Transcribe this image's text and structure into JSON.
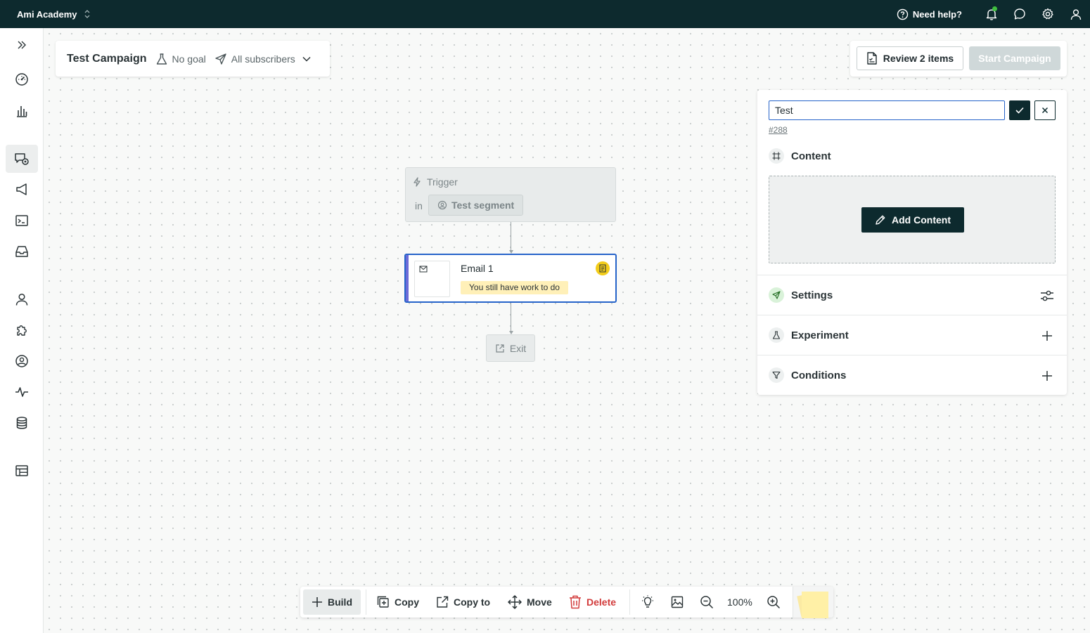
{
  "topbar": {
    "workspace": "Ami Academy",
    "help_label": "Need help?"
  },
  "campaign": {
    "title": "Test Campaign",
    "goal": "No goal",
    "audience": "All subscribers"
  },
  "actions": {
    "review_label": "Review 2 items",
    "start_label": "Start Campaign"
  },
  "flow": {
    "trigger_label": "Trigger",
    "trigger_in": "in",
    "segment": "Test segment",
    "email_title": "Email 1",
    "email_status": "You still have work to do",
    "exit_label": "Exit"
  },
  "panel": {
    "name_value": "Test",
    "message_id": "#288",
    "content_label": "Content",
    "add_content_label": "Add Content",
    "settings_label": "Settings",
    "experiment_label": "Experiment",
    "conditions_label": "Conditions"
  },
  "toolbar": {
    "build": "Build",
    "copy": "Copy",
    "copy_to": "Copy to",
    "move": "Move",
    "delete": "Delete",
    "zoom": "100%"
  },
  "colors": {
    "topbar": "#0d2a2e",
    "selected_border": "#2563c9",
    "warning_badge": "#fff0b8",
    "status_dot": "#f2cc1a",
    "delete": "#d23b3b"
  }
}
